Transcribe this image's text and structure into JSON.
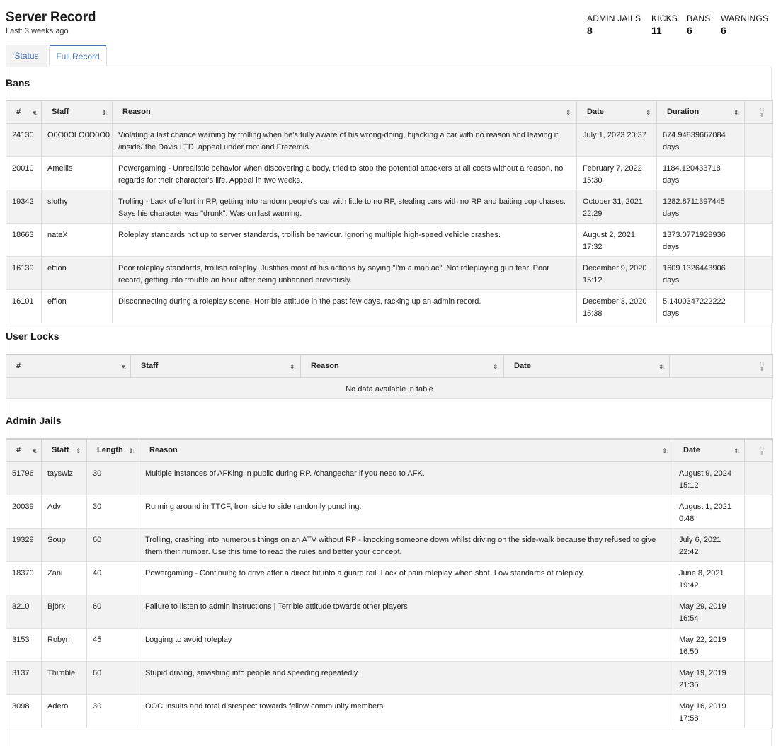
{
  "header": {
    "title": "Server Record",
    "subtitle": "Last: 3 weeks ago"
  },
  "stats": [
    {
      "label": "ADMIN JAILS",
      "value": "8"
    },
    {
      "label": "KICKS",
      "value": "11"
    },
    {
      "label": "BANS",
      "value": "6"
    },
    {
      "label": "WARNINGS",
      "value": "6"
    }
  ],
  "tabs": [
    {
      "label": "Status",
      "active": false
    },
    {
      "label": "Full Record",
      "active": true
    }
  ],
  "bans": {
    "title": "Bans",
    "columns": [
      "#",
      "Staff",
      "Reason",
      "Date",
      "Duration",
      ""
    ],
    "rows": [
      [
        "24130",
        "O0O0OLO0O0O0",
        "Violating a last chance warning by trolling when he's fully aware of his wrong-doing, hijacking a car with no reason and leaving it /inside/ the Davis LTD, appeal under root and Frezemis.",
        "July 1, 2023 20:37",
        "674.94839667084 days",
        ""
      ],
      [
        "20010",
        "Amellis",
        "Powergaming - Unrealistic behavior when discovering a body, tried to stop the potential attackers at all costs without a reason, no regards for their character's life. Appeal in two weeks.",
        "February 7, 2022 15:30",
        "1184.120433718 days",
        ""
      ],
      [
        "19342",
        "slothy",
        "Trolling - Lack of effort in RP, getting into random people's car with little to no RP, stealing cars with no RP and baiting cop chases. Says his character was \"drunk\". Was on last warning.",
        "October 31, 2021 22:29",
        "1282.8711397445 days",
        ""
      ],
      [
        "18663",
        "nateX",
        "Roleplay standards not up to server standards, trollish behaviour. Ignoring multiple high-speed vehicle crashes.",
        "August 2, 2021 17:32",
        "1373.0771929936 days",
        ""
      ],
      [
        "16139",
        "effion",
        "Poor roleplay standards, trollish roleplay. Justifies most of his actions by saying \"I'm a maniac\". Not roleplaying gun fear. Poor record, getting into trouble an hour after being unbanned previously.",
        "December 9, 2020 15:12",
        "1609.1326443906 days",
        ""
      ],
      [
        "16101",
        "effion",
        "Disconnecting during a roleplay scene. Horrible attitude in the past few days, racking up an admin record.",
        "December 3, 2020 15:38",
        "5.1400347222222 days",
        ""
      ]
    ]
  },
  "user_locks": {
    "title": "User Locks",
    "columns": [
      "#",
      "Staff",
      "Reason",
      "Date",
      ""
    ],
    "empty_text": "No data available in table"
  },
  "admin_jails": {
    "title": "Admin Jails",
    "columns": [
      "#",
      "Staff",
      "Length",
      "Reason",
      "Date",
      ""
    ],
    "rows": [
      [
        "51796",
        "tayswiz",
        "30",
        "Multiple instances of AFKing in public during RP. /changechar if you need to AFK.",
        "August 9, 2024 15:12",
        ""
      ],
      [
        "20039",
        "Adv",
        "30",
        "Running around in TTCF, from side to side randomly punching.",
        "August 1, 2021 0:48",
        ""
      ],
      [
        "19329",
        "Soup",
        "60",
        "Trolling, crashing into numerous things on an ATV without RP - knocking someone down whilst driving on the side-walk because they refused to give them their number. Use this time to read the rules and better your concept.",
        "July 6, 2021 22:42",
        ""
      ],
      [
        "18370",
        "Zani",
        "40",
        "Powergaming - Continuing to drive after a direct hit into a guard rail. Lack of pain roleplay when shot. Low standards of roleplay.",
        "June 8, 2021 19:42",
        ""
      ],
      [
        "3210",
        "Björk",
        "60",
        "Failure to listen to admin instructions | Terrible attitude towards other players",
        "May 29, 2019 16:54",
        ""
      ],
      [
        "3153",
        "Robyn",
        "45",
        "Logging to avoid roleplay",
        "May 22, 2019 16:50",
        ""
      ],
      [
        "3137",
        "Thimble",
        "60",
        "Stupid driving, smashing into people and speeding repeatedly.",
        "May 19, 2019 21:35",
        ""
      ],
      [
        "3098",
        "Adero",
        "30",
        "OOC Insults and total disrespect towards fellow community members",
        "May 16, 2019 17:58",
        ""
      ]
    ]
  }
}
